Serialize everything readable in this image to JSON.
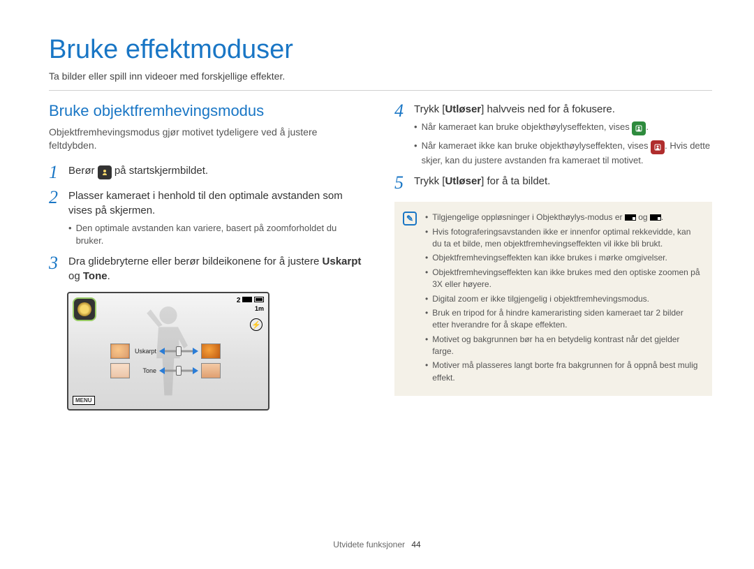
{
  "page": {
    "title": "Bruke effektmoduser",
    "subtitle": "Ta bilder eller spill inn videoer med forskjellige effekter."
  },
  "left": {
    "section_title": "Bruke objektfremhevingsmodus",
    "section_desc": "Objektfremhevingsmodus gjør motivet tydeligere ved å justere feltdybden.",
    "step1_a": "Berør ",
    "step1_b": " på startskjermbildet.",
    "step2": "Plasser kameraet i henhold til den optimale avstanden som vises på skjermen.",
    "step2_sub": "Den optimale avstanden kan variere, basert på zoomforholdet du bruker.",
    "step3_a": "Dra glidebryterne eller berør bildeikonene for å justere ",
    "step3_b": "Uskarpt",
    "step3_c": " og ",
    "step3_d": "Tone",
    "step3_e": "."
  },
  "camera": {
    "count": "2",
    "res": "1m",
    "slider1_label": "Uskarpt",
    "slider2_label": "Tone",
    "menu": "MENU"
  },
  "right": {
    "step4_a": "Trykk [",
    "step4_b": "Utløser",
    "step4_c": "] halvveis ned for å fokusere.",
    "step4_sub1": "Når kameraet kan bruke objekthøylyseffekten, vises ",
    "step4_sub1b": ".",
    "step4_sub2": "Når kameraet ikke kan bruke objekthøylyseffekten, vises ",
    "step4_sub2b": ". Hvis dette skjer, kan du justere avstanden fra kameraet til motivet.",
    "step5_a": "Trykk [",
    "step5_b": "Utløser",
    "step5_c": "] for å ta bildet."
  },
  "notes": {
    "n1a": "Tilgjengelige oppløsninger i Objekthøylys-modus er ",
    "n1b": " og ",
    "n1c": ".",
    "n2": "Hvis fotograferingsavstanden ikke er innenfor optimal rekkevidde, kan du ta et bilde, men objektfremhevingseffekten vil ikke bli brukt.",
    "n3": "Objektfremhevingseffekten kan ikke brukes i mørke omgivelser.",
    "n4": "Objektfremhevingseffekten kan ikke brukes med den optiske zoomen på 3X eller høyere.",
    "n5": "Digital zoom er ikke tilgjengelig i objektfremhevingsmodus.",
    "n6": "Bruk en tripod for å hindre kameraristing siden kameraet tar 2 bilder etter hverandre for å skape effekten.",
    "n7": "Motivet og bakgrunnen bør ha en betydelig kontrast når det gjelder farge.",
    "n8": "Motiver må plasseres langt borte fra bakgrunnen for å oppnå best mulig effekt."
  },
  "footer": {
    "section": "Utvidete funksjoner",
    "page_num": "44"
  }
}
